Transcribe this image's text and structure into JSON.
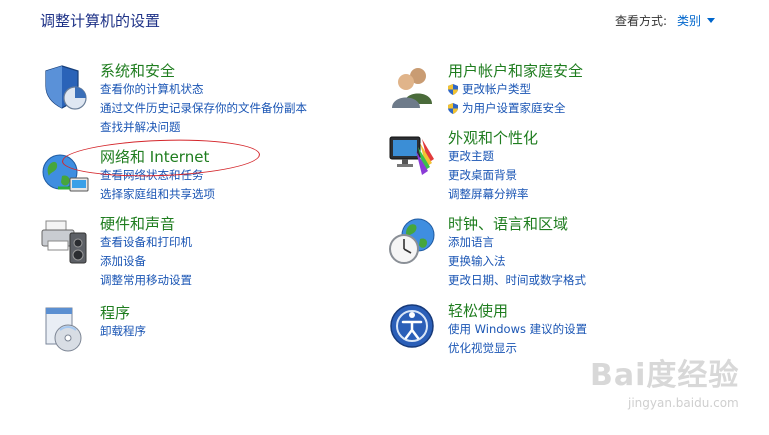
{
  "header": {
    "title": "调整计算机的设置",
    "view_by_label": "查看方式:",
    "view_by_value": "类别"
  },
  "categories": [
    {
      "id": "system-security",
      "icon": "shield-chart-icon",
      "title": "系统和安全",
      "links": [
        "查看你的计算机状态",
        "通过文件历史记录保存你的文件备份副本",
        "查找并解决问题"
      ]
    },
    {
      "id": "network-internet",
      "icon": "globe-network-icon",
      "title": "网络和 Internet",
      "links": [
        "查看网络状态和任务",
        "选择家庭组和共享选项"
      ]
    },
    {
      "id": "hardware-sound",
      "icon": "printer-speaker-icon",
      "title": "硬件和声音",
      "links": [
        "查看设备和打印机",
        "添加设备",
        "调整常用移动设置"
      ]
    },
    {
      "id": "programs",
      "icon": "programs-disc-icon",
      "title": "程序",
      "links": [
        "卸载程序"
      ]
    },
    {
      "id": "user-accounts",
      "icon": "users-icon",
      "title": "用户帐户和家庭安全",
      "links": [
        "更改帐户类型",
        "为用户设置家庭安全"
      ]
    },
    {
      "id": "appearance",
      "icon": "monitor-palette-icon",
      "title": "外观和个性化",
      "links": [
        "更改主题",
        "更改桌面背景",
        "调整屏幕分辨率"
      ]
    },
    {
      "id": "clock-language",
      "icon": "clock-globe-icon",
      "title": "时钟、语言和区域",
      "links": [
        "添加语言",
        "更换输入法",
        "更改日期、时间或数字格式"
      ]
    },
    {
      "id": "ease-of-access",
      "icon": "ease-of-access-icon",
      "title": "轻松使用",
      "links": [
        "使用 Windows 建议的设置",
        "优化视觉显示"
      ]
    }
  ],
  "watermark": {
    "brand": "Bai度经验",
    "url": "jingyan.baidu.com"
  },
  "colors": {
    "heading_green": "#1f7d1f",
    "link_blue": "#1a55b4",
    "title_blue": "#1e3287",
    "highlight_red": "#d4262b"
  }
}
